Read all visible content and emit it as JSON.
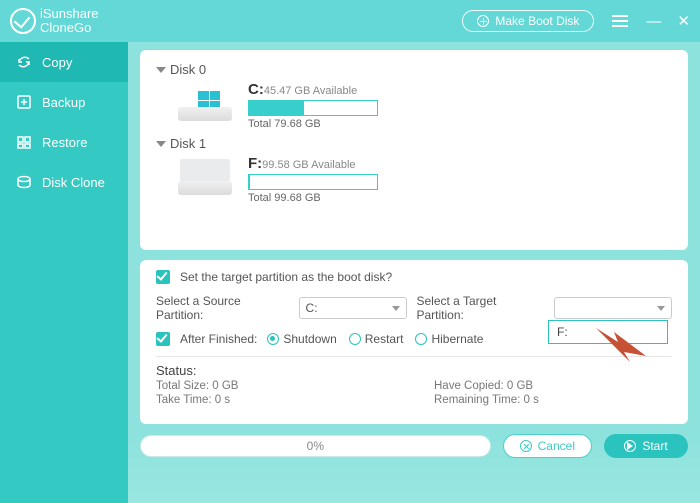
{
  "app": {
    "name1": "iSunshare",
    "name2": "CloneGo"
  },
  "titlebar": {
    "boot": "Make Boot Disk"
  },
  "nav": {
    "copy": "Copy",
    "backup": "Backup",
    "restore": "Restore",
    "diskclone": "Disk Clone"
  },
  "disks": [
    {
      "header": "Disk 0",
      "letter": "C:",
      "available": "45.47 GB Available",
      "total": "Total 79.68 GB",
      "fill_pct": 43,
      "is_windows": true
    },
    {
      "header": "Disk 1",
      "letter": "F:",
      "available": "99.58 GB Available",
      "total": "Total 99.68 GB",
      "fill_pct": 1,
      "is_windows": false
    }
  ],
  "settings": {
    "boot_q": "Set the target partition as the boot disk?",
    "source_label": "Select a Source Partition:",
    "source_value": "C:",
    "target_label": "Select a Target Partition:",
    "target_value": "",
    "after_label": "After Finished:",
    "radio_shutdown": "Shutdown",
    "radio_restart": "Restart",
    "radio_hibernate": "Hibernate",
    "dropdown_option": "F:"
  },
  "status": {
    "title": "Status:",
    "total_size": "Total Size: 0 GB",
    "have_copied": "Have Copied: 0 GB",
    "take_time": "Take Time: 0 s",
    "remaining": "Remaining Time: 0 s"
  },
  "footer": {
    "progress": "0%",
    "cancel": "Cancel",
    "start": "Start"
  }
}
